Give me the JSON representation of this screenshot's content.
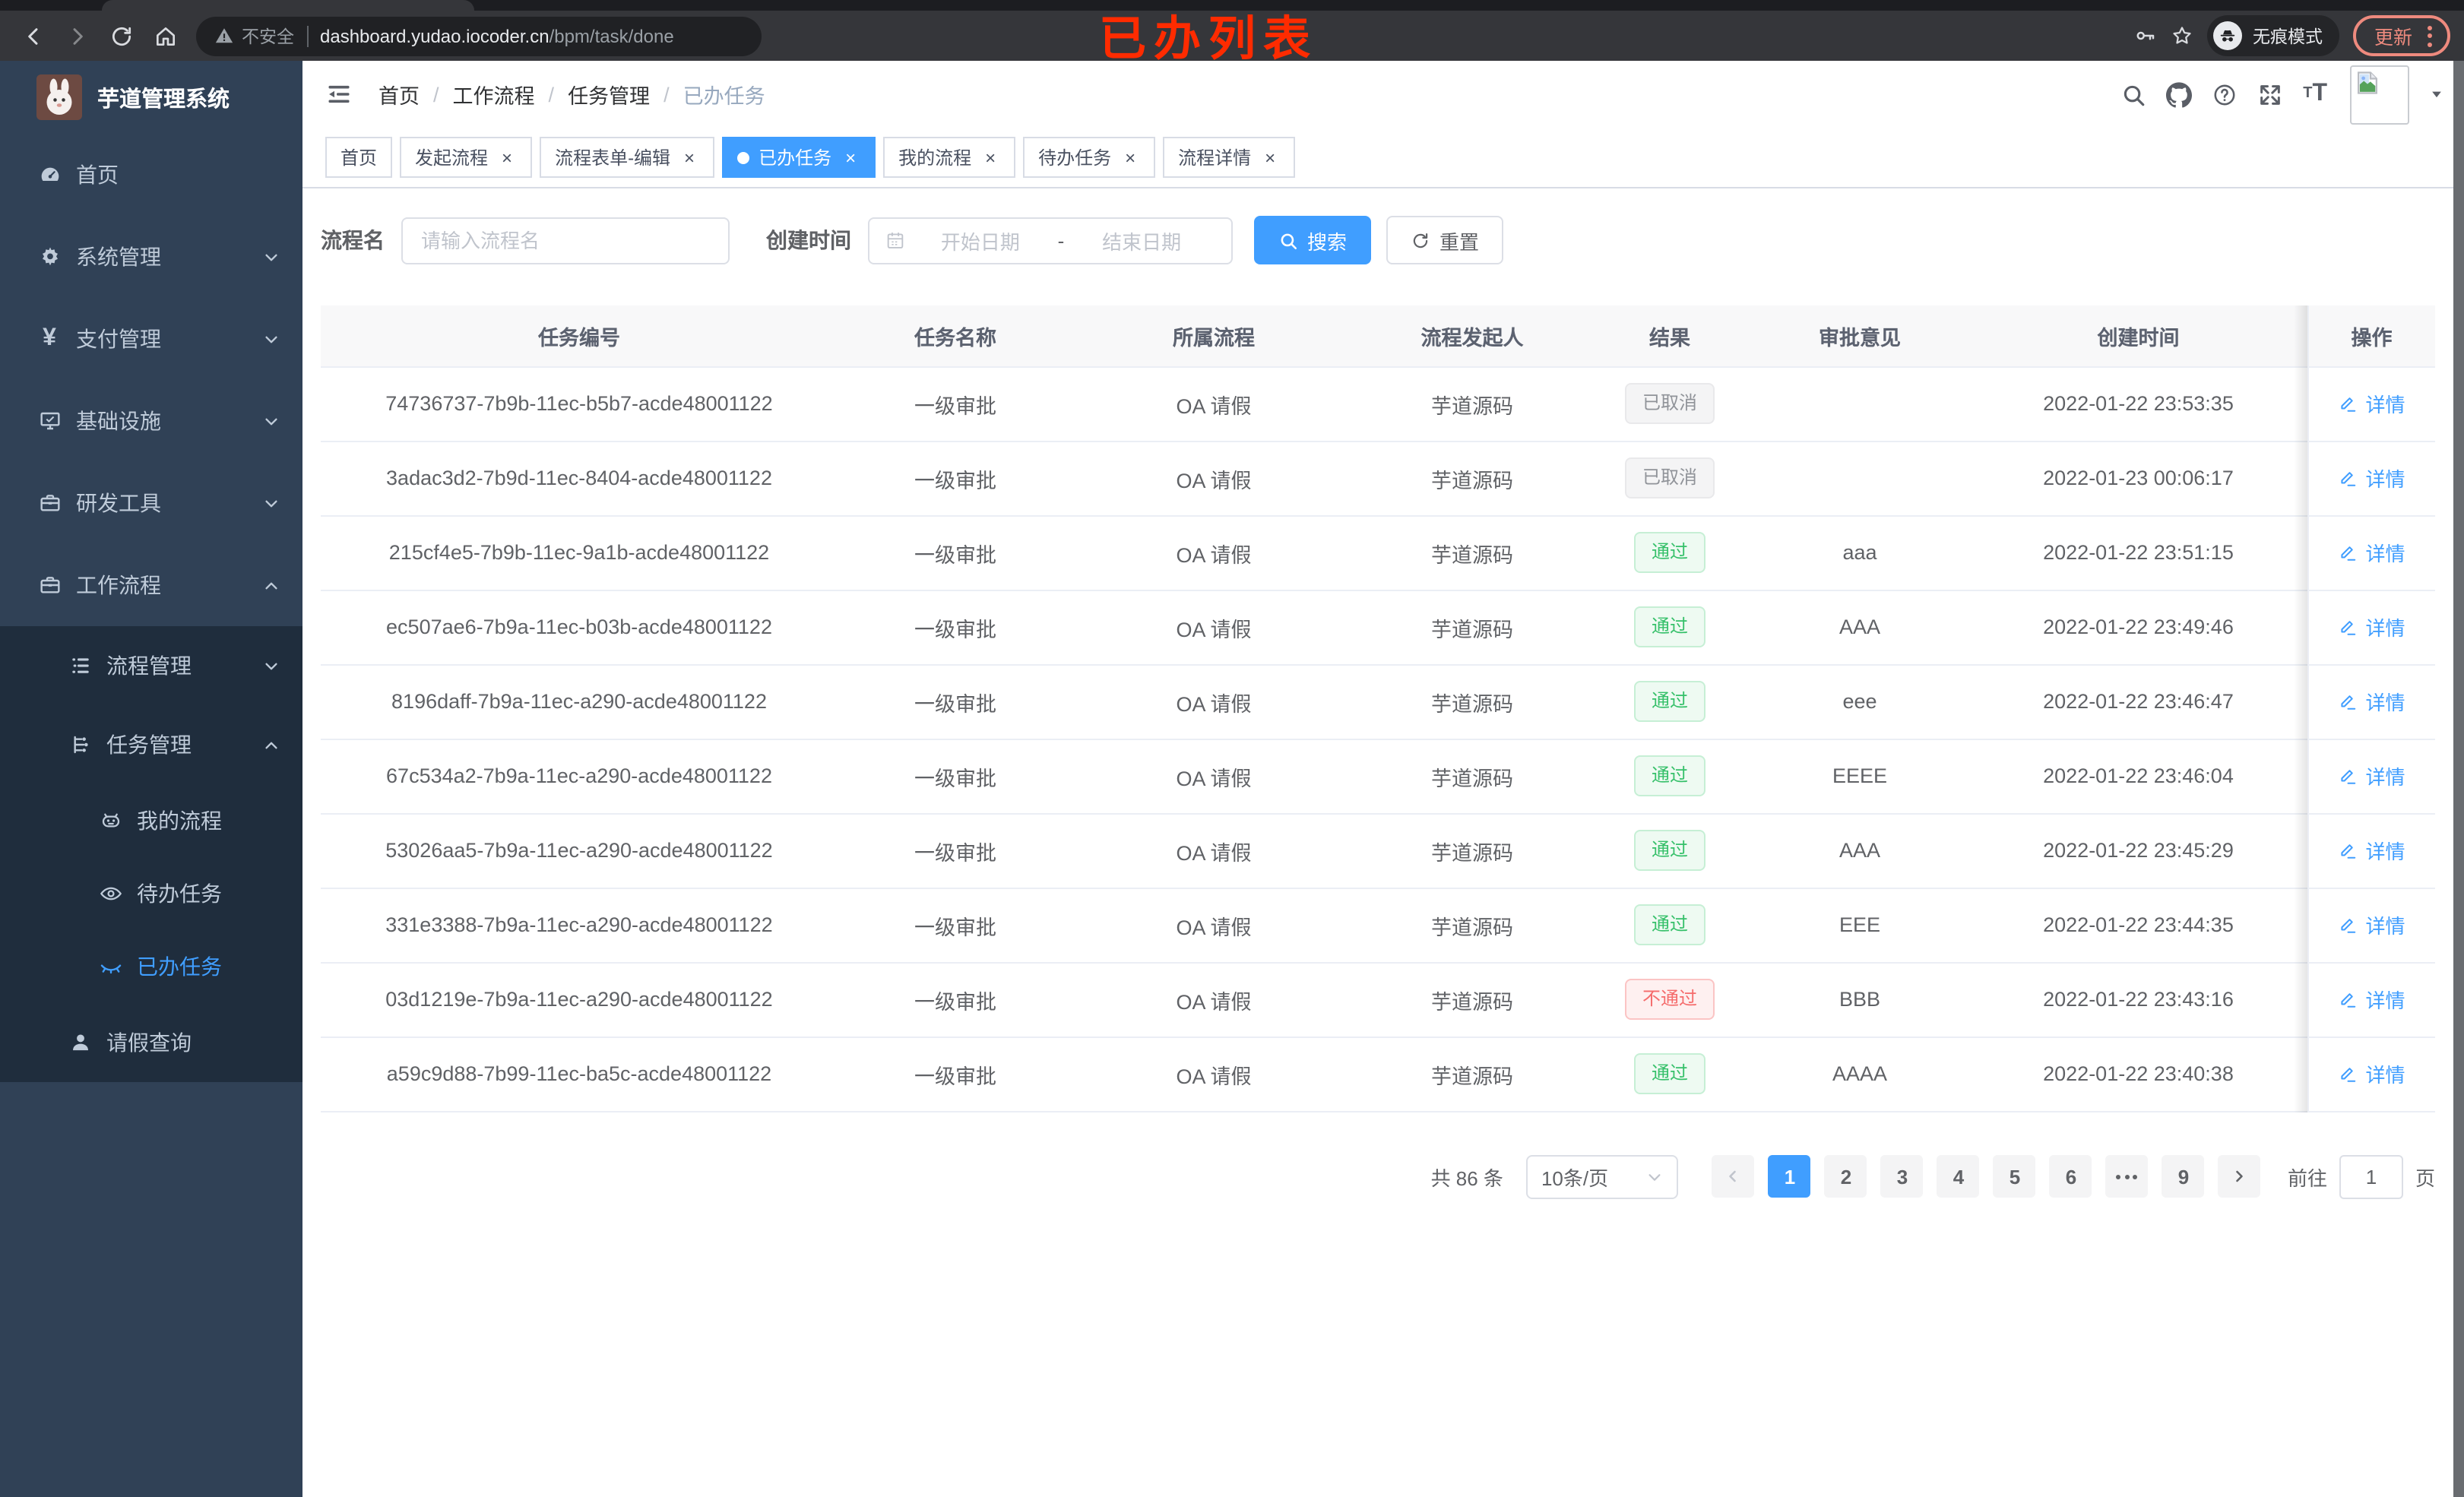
{
  "colors": {
    "accent": "#409eff",
    "success": "#36c06a",
    "danger": "#f56c6c",
    "info": "#909399",
    "annotation_red": "#ff2b00",
    "sidebar_bg": "#304156",
    "submenu_bg": "#1f2d3d",
    "update_button": "#ee8a7e"
  },
  "browser": {
    "security_label": "不安全",
    "url_domain": "dashboard.yudao.iocoder.cn",
    "url_path": "/bpm/task/done",
    "annotation": "已办列表",
    "incognito_label": "无痕模式",
    "update_label": "更新"
  },
  "sidebar": {
    "title": "芋道管理系统",
    "menu": [
      {
        "label": "首页",
        "icon": "dashboard-icon",
        "level": 1,
        "chevron": "",
        "submenu": false,
        "active": false
      },
      {
        "label": "系统管理",
        "icon": "gear-icon",
        "level": 1,
        "chevron": "down",
        "submenu": false,
        "active": false
      },
      {
        "label": "支付管理",
        "icon": "yen-icon",
        "level": 1,
        "chevron": "down",
        "submenu": false,
        "active": false
      },
      {
        "label": "基础设施",
        "icon": "monitor-icon",
        "level": 1,
        "chevron": "down",
        "submenu": false,
        "active": false
      },
      {
        "label": "研发工具",
        "icon": "toolbox-icon",
        "level": 1,
        "chevron": "down",
        "submenu": false,
        "active": false
      },
      {
        "label": "工作流程",
        "icon": "briefcase-icon",
        "level": 1,
        "chevron": "up",
        "submenu": false,
        "active": false
      },
      {
        "label": "流程管理",
        "icon": "list-tree-icon",
        "level": 2,
        "chevron": "down",
        "submenu": true,
        "active": false
      },
      {
        "label": "任务管理",
        "icon": "flow-tree-icon",
        "level": 2,
        "chevron": "up",
        "submenu": true,
        "active": false
      },
      {
        "label": "我的流程",
        "icon": "robot-icon",
        "level": 3,
        "chevron": "",
        "submenu": true,
        "active": false
      },
      {
        "label": "待办任务",
        "icon": "eye-icon",
        "level": 3,
        "chevron": "",
        "submenu": true,
        "active": false
      },
      {
        "label": "已办任务",
        "icon": "eye-closed-icon",
        "level": 3,
        "chevron": "",
        "submenu": true,
        "active": true
      },
      {
        "label": "请假查询",
        "icon": "user-icon",
        "level": 2,
        "chevron": "",
        "submenu": true,
        "active": false
      }
    ]
  },
  "header": {
    "breadcrumb": [
      "首页",
      "工作流程",
      "任务管理",
      "已办任务"
    ]
  },
  "tabs": [
    {
      "label": "首页",
      "closable": false,
      "active": false
    },
    {
      "label": "发起流程",
      "closable": true,
      "active": false
    },
    {
      "label": "流程表单-编辑",
      "closable": true,
      "active": false
    },
    {
      "label": "已办任务",
      "closable": true,
      "active": true
    },
    {
      "label": "我的流程",
      "closable": true,
      "active": false
    },
    {
      "label": "待办任务",
      "closable": true,
      "active": false
    },
    {
      "label": "流程详情",
      "closable": true,
      "active": false
    }
  ],
  "filters": {
    "name_label": "流程名",
    "name_placeholder": "请输入流程名",
    "time_label": "创建时间",
    "start_placeholder": "开始日期",
    "range_separator": "-",
    "end_placeholder": "结束日期",
    "search_label": "搜索",
    "reset_label": "重置"
  },
  "table": {
    "columns": [
      "任务编号",
      "任务名称",
      "所属流程",
      "流程发起人",
      "结果",
      "审批意见",
      "创建时间",
      "操作"
    ],
    "action_label": "详情",
    "rows": [
      {
        "id": "74736737-7b9b-11ec-b5b7-acde48001122",
        "name": "一级审批",
        "process": "OA 请假",
        "starter": "芋道源码",
        "result": "已取消",
        "result_type": "info",
        "opinion": "",
        "time": "2022-01-22 23:53:35"
      },
      {
        "id": "3adac3d2-7b9d-11ec-8404-acde48001122",
        "name": "一级审批",
        "process": "OA 请假",
        "starter": "芋道源码",
        "result": "已取消",
        "result_type": "info",
        "opinion": "",
        "time": "2022-01-23 00:06:17"
      },
      {
        "id": "215cf4e5-7b9b-11ec-9a1b-acde48001122",
        "name": "一级审批",
        "process": "OA 请假",
        "starter": "芋道源码",
        "result": "通过",
        "result_type": "success",
        "opinion": "aaa",
        "time": "2022-01-22 23:51:15"
      },
      {
        "id": "ec507ae6-7b9a-11ec-b03b-acde48001122",
        "name": "一级审批",
        "process": "OA 请假",
        "starter": "芋道源码",
        "result": "通过",
        "result_type": "success",
        "opinion": "AAA",
        "time": "2022-01-22 23:49:46"
      },
      {
        "id": "8196daff-7b9a-11ec-a290-acde48001122",
        "name": "一级审批",
        "process": "OA 请假",
        "starter": "芋道源码",
        "result": "通过",
        "result_type": "success",
        "opinion": "eee",
        "time": "2022-01-22 23:46:47"
      },
      {
        "id": "67c534a2-7b9a-11ec-a290-acde48001122",
        "name": "一级审批",
        "process": "OA 请假",
        "starter": "芋道源码",
        "result": "通过",
        "result_type": "success",
        "opinion": "EEEE",
        "time": "2022-01-22 23:46:04"
      },
      {
        "id": "53026aa5-7b9a-11ec-a290-acde48001122",
        "name": "一级审批",
        "process": "OA 请假",
        "starter": "芋道源码",
        "result": "通过",
        "result_type": "success",
        "opinion": "AAA",
        "time": "2022-01-22 23:45:29"
      },
      {
        "id": "331e3388-7b9a-11ec-a290-acde48001122",
        "name": "一级审批",
        "process": "OA 请假",
        "starter": "芋道源码",
        "result": "通过",
        "result_type": "success",
        "opinion": "EEE",
        "time": "2022-01-22 23:44:35"
      },
      {
        "id": "03d1219e-7b9a-11ec-a290-acde48001122",
        "name": "一级审批",
        "process": "OA 请假",
        "starter": "芋道源码",
        "result": "不通过",
        "result_type": "danger",
        "opinion": "BBB",
        "time": "2022-01-22 23:43:16"
      },
      {
        "id": "a59c9d88-7b99-11ec-ba5c-acde48001122",
        "name": "一级审批",
        "process": "OA 请假",
        "starter": "芋道源码",
        "result": "通过",
        "result_type": "success",
        "opinion": "AAAA",
        "time": "2022-01-22 23:40:38"
      }
    ]
  },
  "pagination": {
    "total_text": "共 86 条",
    "page_size": "10条/页",
    "pages": [
      "1",
      "2",
      "3",
      "4",
      "5",
      "6",
      "more",
      "9"
    ],
    "active_page": "1",
    "goto_label": "前往",
    "goto_value": "1",
    "goto_suffix": "页"
  }
}
